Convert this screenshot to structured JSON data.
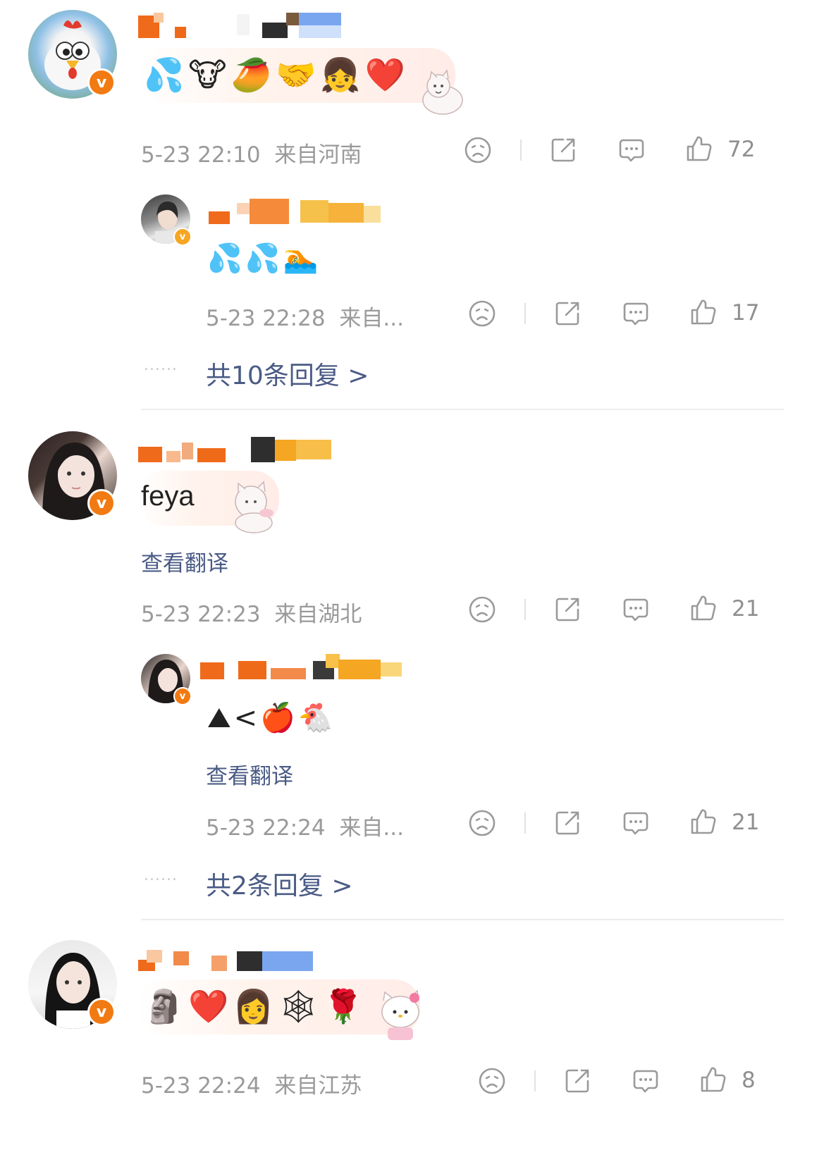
{
  "comments": [
    {
      "emojis": "💦🐮🥭🤝👧❤️",
      "timestamp": "5-23 22:10",
      "location": "来自河南",
      "likes": "72",
      "reply": {
        "emojis": "💦💦🏊",
        "timestamp": "5-23 22:28",
        "location": "来自...",
        "likes": "17"
      },
      "replies_link": "共10条回复 >"
    },
    {
      "text": "feya",
      "translate_label": "查看翻译",
      "timestamp": "5-23 22:23",
      "location": "来自湖北",
      "likes": "21",
      "reply": {
        "emojis": "⛰<🍎🐔",
        "translate_label": "查看翻译",
        "timestamp": "5-23 22:24",
        "location": "来自...",
        "likes": "21"
      },
      "replies_link": "共2条回复 >"
    },
    {
      "emojis": "🗿❤️👩🕸🌹",
      "timestamp": "5-23 22:24",
      "location": "来自江苏",
      "likes": "8"
    }
  ],
  "badge_letter": "v",
  "dots": "......",
  "icons": {
    "dislike": "sad-face-icon",
    "share": "share-icon",
    "comment": "comment-bubble-icon",
    "like": "thumbs-up-icon"
  },
  "colors": {
    "link": "#4a5b85",
    "meta": "#9a9a9a",
    "badge": "#f27a12"
  }
}
